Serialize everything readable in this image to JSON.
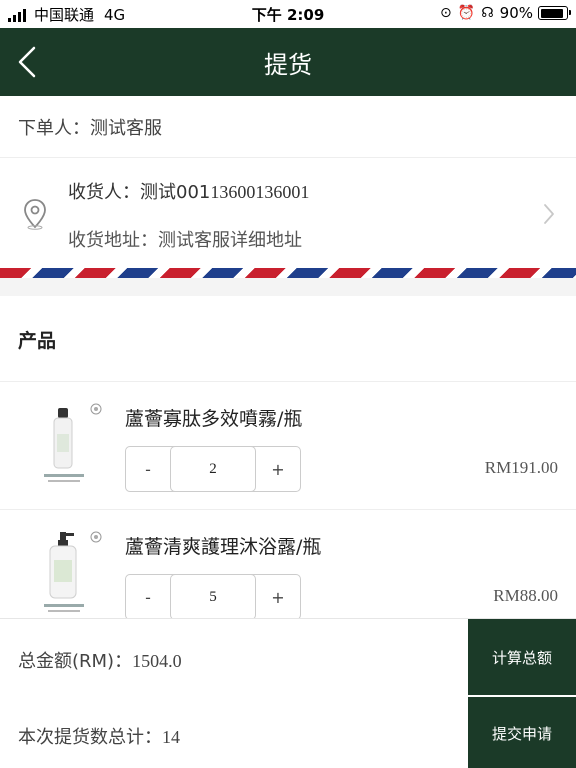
{
  "status_bar": {
    "carrier": "中国联通",
    "network": "4G",
    "time": "下午 2:09",
    "battery_percent": "90%",
    "battery_level": 0.9,
    "icons": [
      "rotation-lock-icon",
      "alarm-icon",
      "headphones-icon"
    ]
  },
  "nav": {
    "title": "提货",
    "back_icon": "chevron-left-icon"
  },
  "order": {
    "orderer_label": "下单人：",
    "orderer_name": "测试客服"
  },
  "address": {
    "recipient_label": "收货人：",
    "recipient_name": "测试001",
    "phone": "13600136001",
    "address_label": "收货地址：",
    "address_value": "测试客服详细地址"
  },
  "products": {
    "header": "产品",
    "items": [
      {
        "name": "蘆薈寡肽多效噴霧/瓶",
        "quantity": "2",
        "price": "RM191.00",
        "minus": "-",
        "plus": "+"
      },
      {
        "name": "蘆薈清爽護理沐浴露/瓶",
        "quantity": "5",
        "price": "RM88.00",
        "minus": "-",
        "plus": "+"
      }
    ]
  },
  "summary": {
    "total_label": "总金额(RM)：",
    "total_value": "1504.0",
    "count_label": "本次提货数总计：",
    "count_value": "14",
    "calculate_button": "计算总额",
    "submit_button": "提交申请"
  },
  "colors": {
    "primary": "#1b3a28",
    "airmail_red": "#c9202e",
    "airmail_blue": "#1f3f8c"
  }
}
